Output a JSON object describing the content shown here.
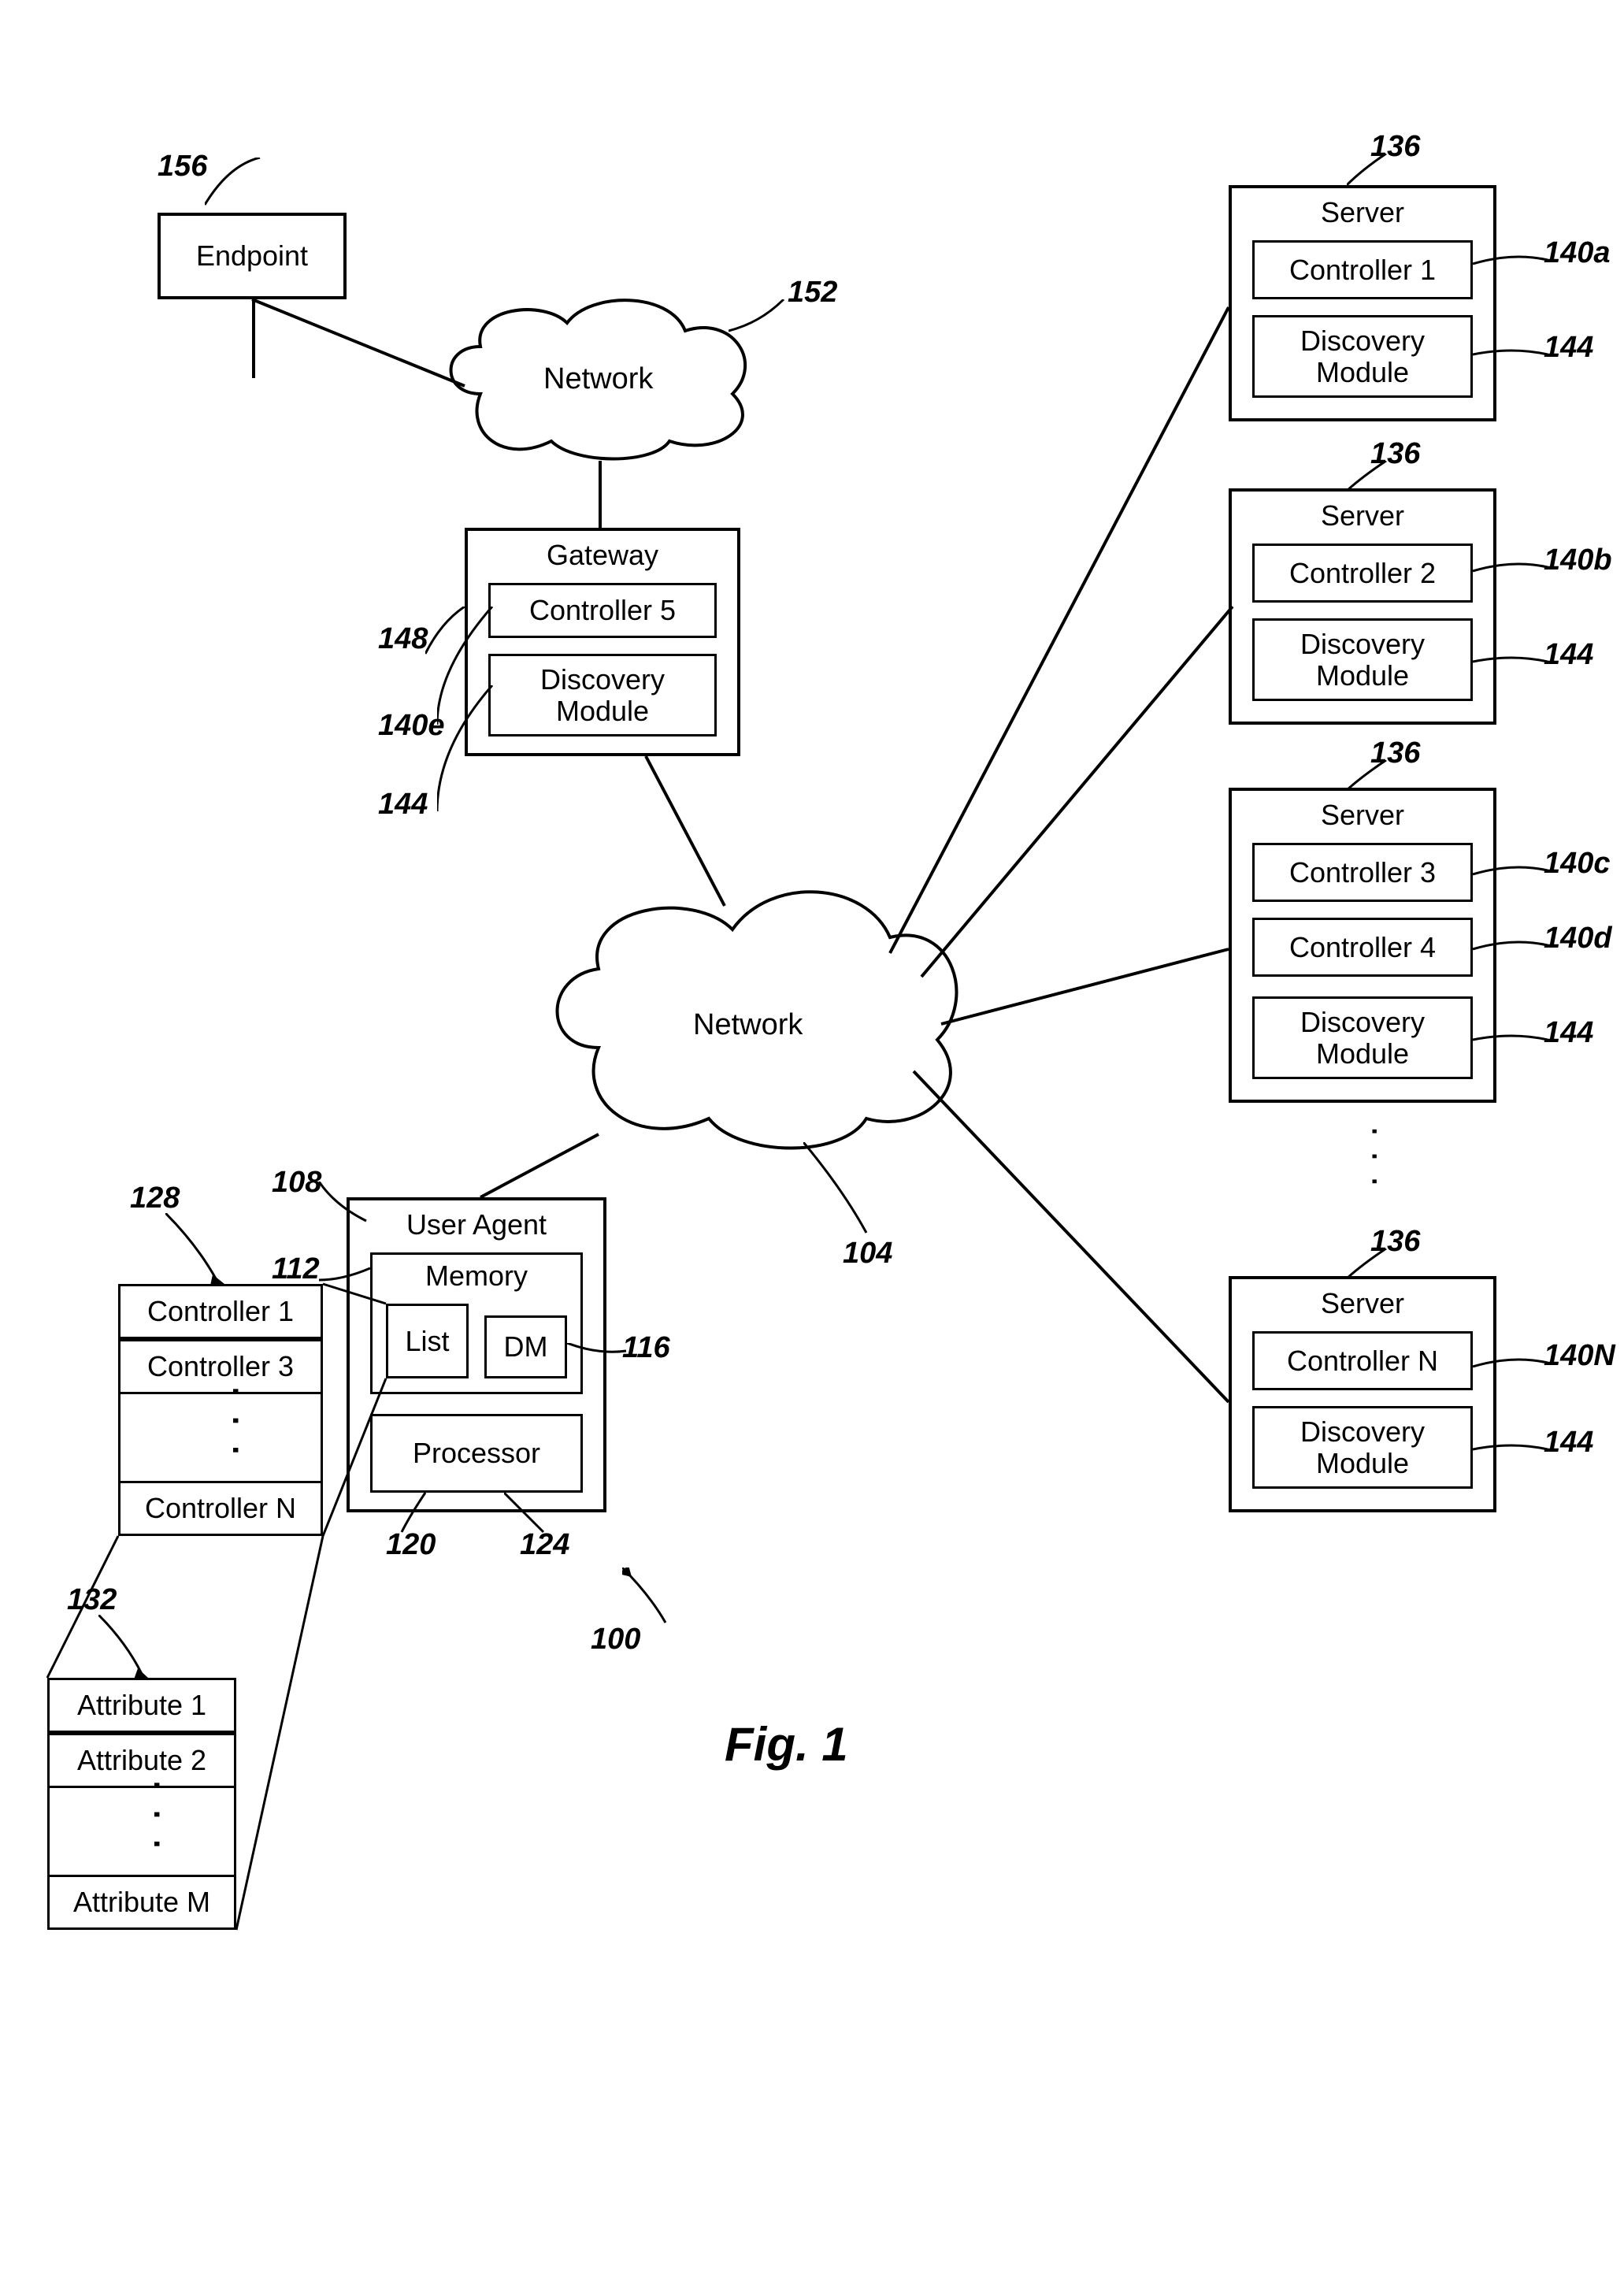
{
  "figure_label": "Fig. 1",
  "system_ref": "100",
  "endpoint": {
    "label": "Endpoint",
    "ref": "156"
  },
  "network2": {
    "label": "Network",
    "ref": "152"
  },
  "gateway": {
    "label": "Gateway",
    "ref": "148",
    "controller": {
      "label": "Controller 5",
      "ref": "140e"
    },
    "discovery": {
      "label": "Discovery Module",
      "ref": "144"
    }
  },
  "network1": {
    "label": "Network",
    "ref": "104"
  },
  "user_agent": {
    "label": "User Agent",
    "ref": "108",
    "memory": {
      "label": "Memory",
      "ref": "112"
    },
    "list": {
      "label": "List",
      "ref": "120"
    },
    "dm": {
      "label": "DM",
      "ref": "116"
    },
    "processor": {
      "label": "Processor",
      "ref": "124"
    }
  },
  "controller_list": {
    "ref": "128",
    "items": [
      "Controller 1",
      "Controller 3",
      "Controller N"
    ]
  },
  "attribute_list": {
    "ref": "132",
    "items": [
      "Attribute 1",
      "Attribute 2",
      "Attribute M"
    ]
  },
  "servers": [
    {
      "label": "Server",
      "ref": "136",
      "controllers": [
        {
          "label": "Controller 1",
          "ref": "140a"
        }
      ],
      "discovery": {
        "label": "Discovery Module",
        "ref": "144"
      }
    },
    {
      "label": "Server",
      "ref": "136",
      "controllers": [
        {
          "label": "Controller 2",
          "ref": "140b"
        }
      ],
      "discovery": {
        "label": "Discovery Module",
        "ref": "144"
      }
    },
    {
      "label": "Server",
      "ref": "136",
      "controllers": [
        {
          "label": "Controller 3",
          "ref": "140c"
        },
        {
          "label": "Controller 4",
          "ref": "140d"
        }
      ],
      "discovery": {
        "label": "Discovery Module",
        "ref": "144"
      }
    },
    {
      "label": "Server",
      "ref": "136",
      "controllers": [
        {
          "label": "Controller N",
          "ref": "140N"
        }
      ],
      "discovery": {
        "label": "Discovery Module",
        "ref": "144"
      }
    }
  ]
}
